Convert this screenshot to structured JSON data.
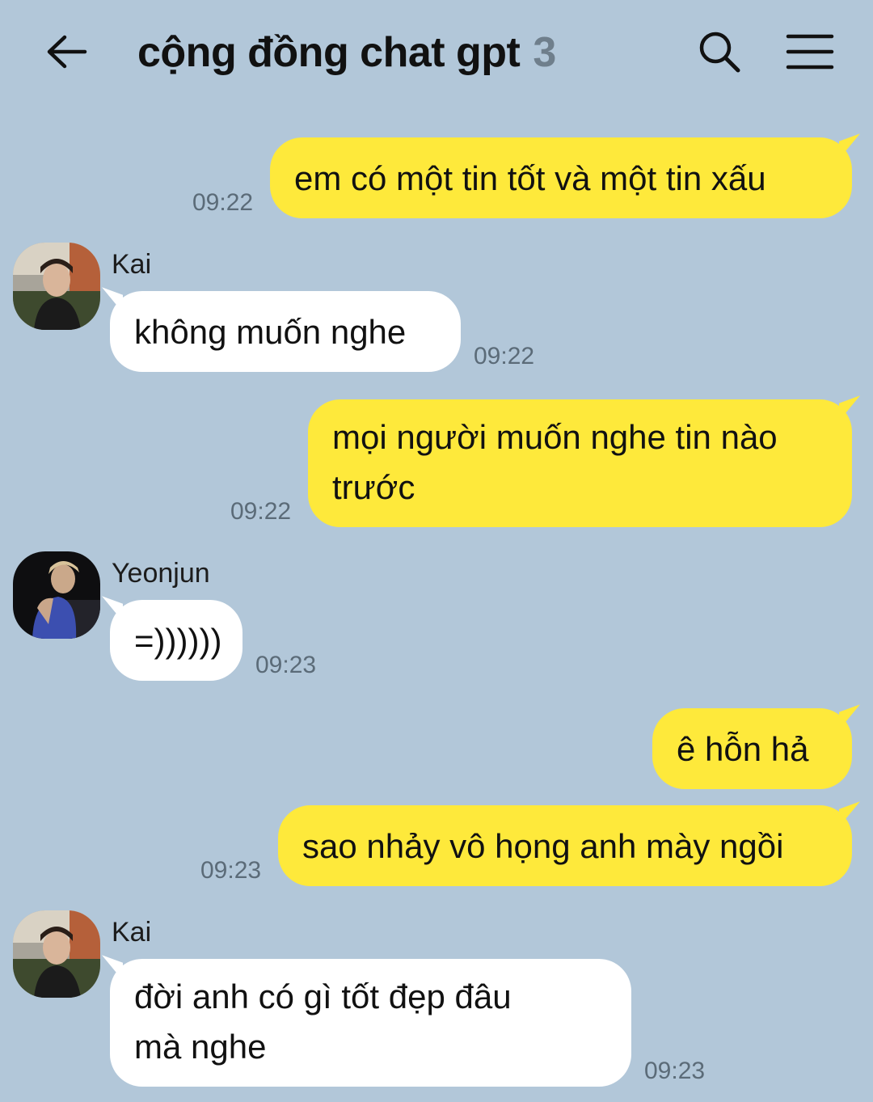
{
  "header": {
    "title": "cộng đồng chat gpt",
    "member_count": "3"
  },
  "messages": [
    {
      "side": "me",
      "text": "em có một tin tốt và một tin xấu",
      "time": "09:22"
    },
    {
      "side": "them",
      "sender": "Kai",
      "text": "không muốn nghe",
      "time": "09:22"
    },
    {
      "side": "me",
      "text_line1": "mọi người muốn nghe tin nào",
      "text_line2": "trước",
      "time": "09:22"
    },
    {
      "side": "them",
      "sender": "Yeonjun",
      "text": "=))))))",
      "time": "09:23"
    },
    {
      "side": "me",
      "text": "ê hỗn hả"
    },
    {
      "side": "me",
      "text": "sao nhảy vô họng anh mày ngồi",
      "time": "09:23"
    },
    {
      "side": "them",
      "sender": "Kai",
      "text_line1": "đời anh có gì tốt đẹp đâu",
      "text_line2": "mà nghe",
      "time": "09:23"
    }
  ],
  "colors": {
    "background": "#b2c7d9",
    "my_bubble": "#fee93b",
    "their_bubble": "#ffffff"
  }
}
